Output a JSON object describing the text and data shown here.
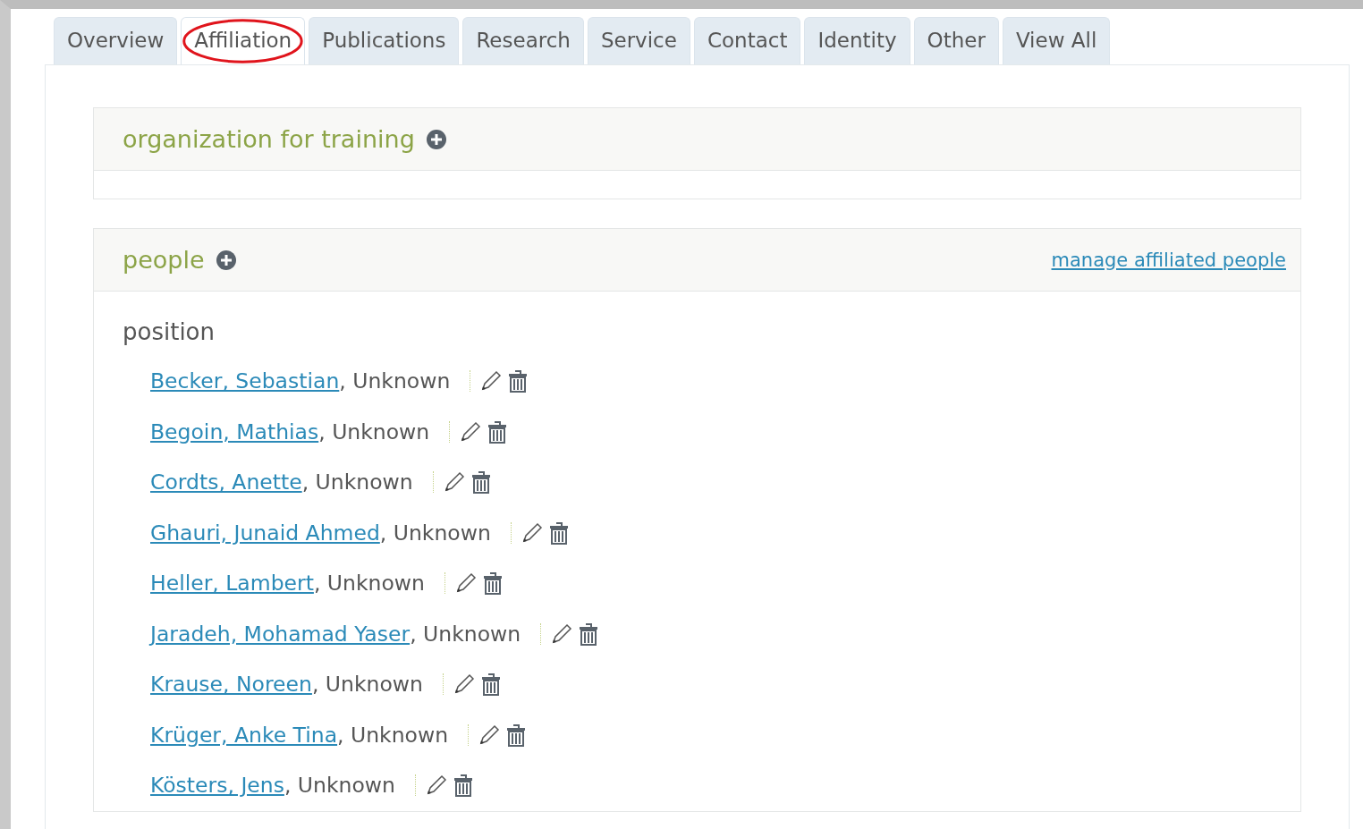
{
  "tabs": [
    {
      "label": "Overview",
      "selected": false,
      "circled": false
    },
    {
      "label": "Affiliation",
      "selected": true,
      "circled": true
    },
    {
      "label": "Publications",
      "selected": false,
      "circled": false
    },
    {
      "label": "Research",
      "selected": false,
      "circled": false
    },
    {
      "label": "Service",
      "selected": false,
      "circled": false
    },
    {
      "label": "Contact",
      "selected": false,
      "circled": false
    },
    {
      "label": "Identity",
      "selected": false,
      "circled": false
    },
    {
      "label": "Other",
      "selected": false,
      "circled": false
    },
    {
      "label": "View All",
      "selected": false,
      "circled": false
    }
  ],
  "sections": [
    {
      "title": "organization for training"
    },
    {
      "title": "people",
      "link": "manage affiliated people",
      "groups": [
        {
          "heading": "position",
          "entries": [
            {
              "name": "Becker, Sebastian",
              "role": ", Unknown"
            },
            {
              "name": "Begoin, Mathias",
              "role": ", Unknown"
            },
            {
              "name": "Cordts, Anette",
              "role": ", Unknown"
            },
            {
              "name": "Ghauri, Junaid Ahmed",
              "role": ", Unknown"
            },
            {
              "name": "Heller, Lambert",
              "role": ", Unknown"
            },
            {
              "name": "Jaradeh, Mohamad Yaser",
              "role": ", Unknown"
            },
            {
              "name": "Krause, Noreen",
              "role": ", Unknown"
            },
            {
              "name": "Krüger, Anke Tina",
              "role": ", Unknown"
            },
            {
              "name": "Kösters, Jens",
              "role": ", Unknown"
            }
          ]
        }
      ]
    }
  ]
}
